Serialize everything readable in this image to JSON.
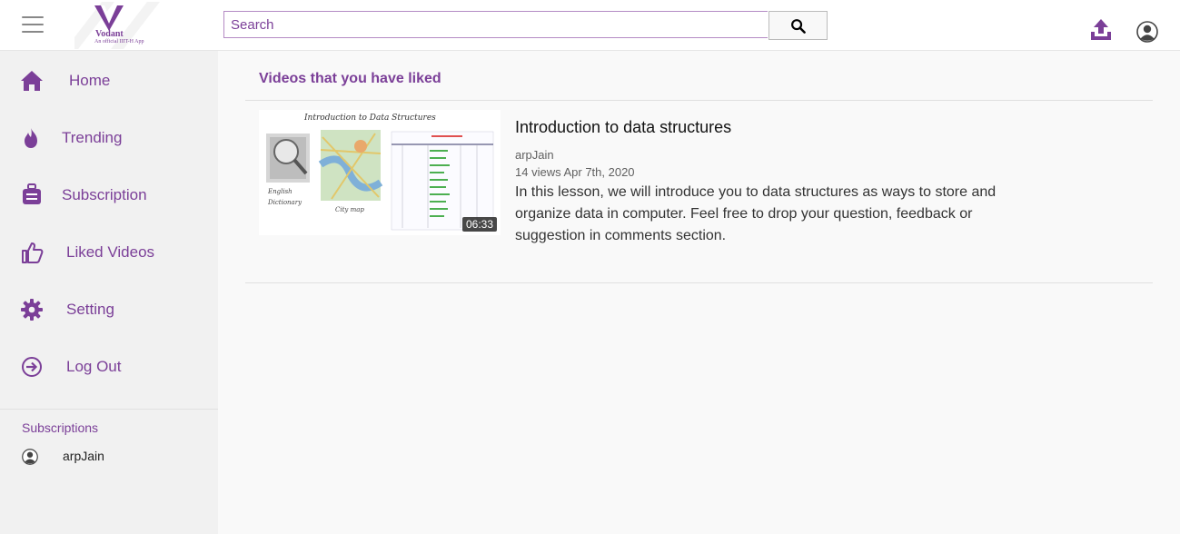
{
  "header": {
    "logo_name": "Vodant",
    "logo_tagline": "An official IIIT-H App",
    "search_placeholder": "Search",
    "icons": {
      "menu": "hamburger-icon",
      "search": "search-icon",
      "upload": "upload-icon",
      "account": "account-icon"
    }
  },
  "sidebar": {
    "items": [
      {
        "label": "Home",
        "icon": "home-icon"
      },
      {
        "label": "Trending",
        "icon": "flame-icon"
      },
      {
        "label": "Subscription",
        "icon": "subscription-icon"
      },
      {
        "label": "Liked Videos",
        "icon": "thumbs-up-icon"
      },
      {
        "label": "Setting",
        "icon": "gear-icon"
      },
      {
        "label": "Log Out",
        "icon": "logout-icon"
      }
    ],
    "subscriptions_title": "Subscriptions",
    "subscriptions": [
      {
        "name": "arpJain",
        "icon": "avatar-icon"
      }
    ]
  },
  "main": {
    "section_title": "Videos that you have liked",
    "videos": [
      {
        "title": "Introduction to data structures",
        "channel": "arpJain",
        "meta": "14 views Apr 7th, 2020",
        "description": "In this lesson, we will introduce you to data structures as ways to store and organize data in computer. Feel free to drop your question, feedback or suggestion in comments section.",
        "duration": "06:33",
        "thumbnail_text": {
          "heading": "Introduction to Data Structures",
          "dictionary": "English Dictionary",
          "map": "City map"
        }
      }
    ]
  },
  "colors": {
    "accent": "#7b3f98",
    "sidebar_bg": "#f1f1f1",
    "page_bg": "#f9f9f9"
  }
}
